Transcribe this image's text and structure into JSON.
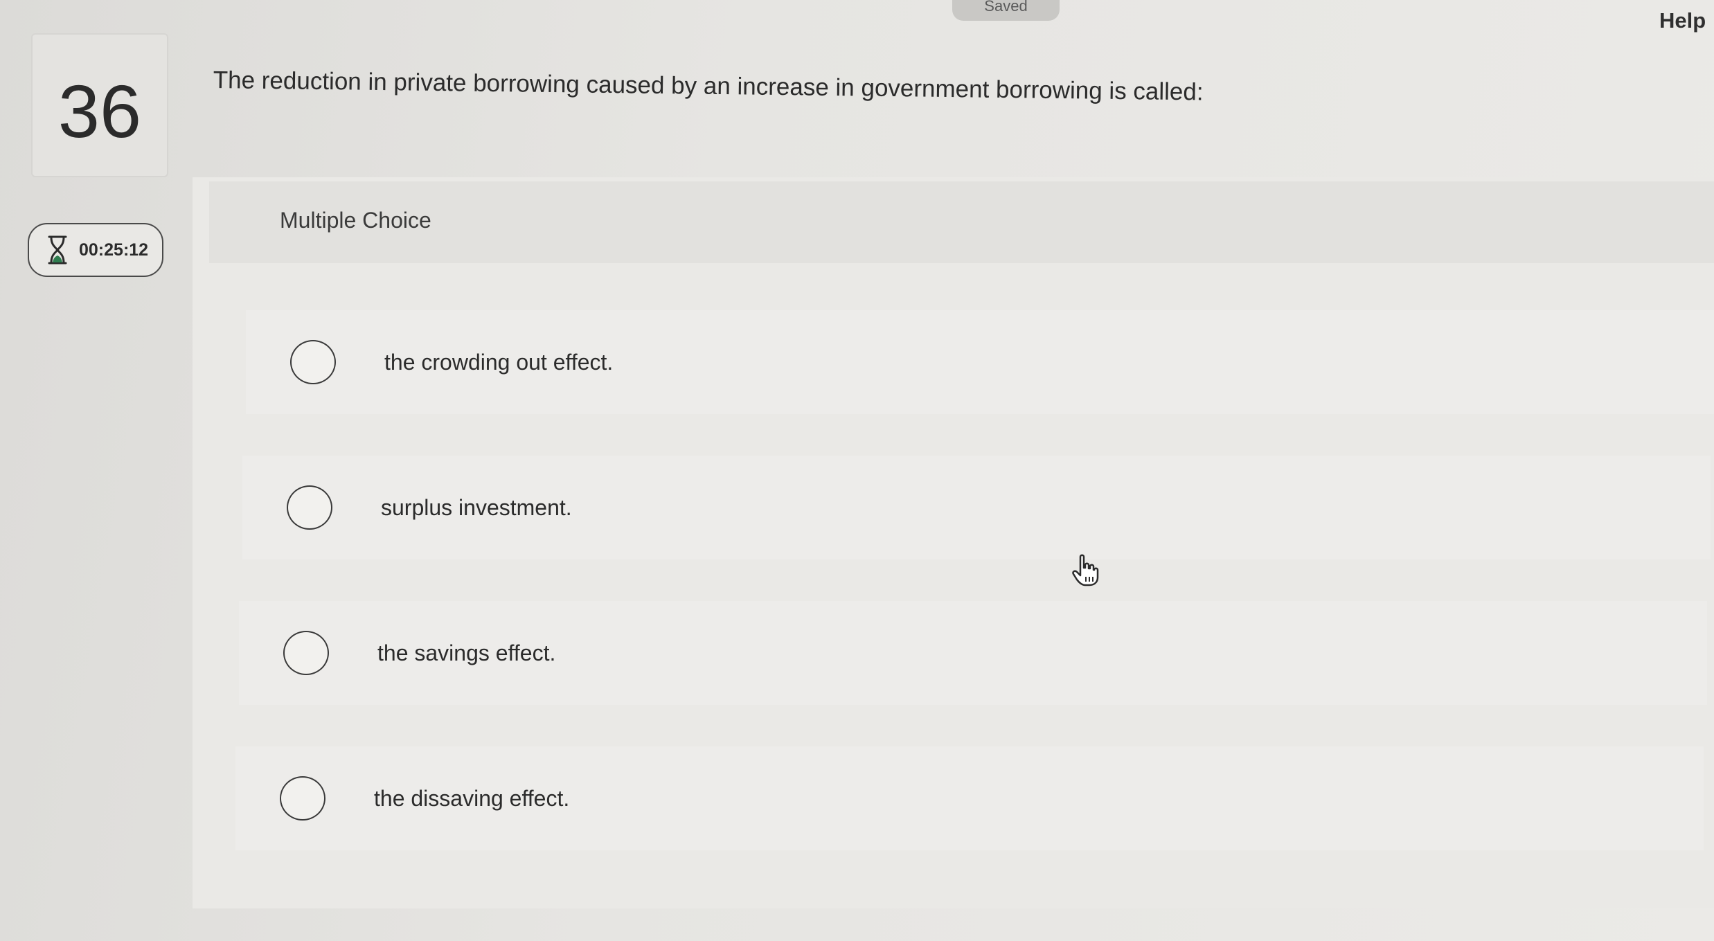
{
  "header": {
    "saved_label": "Saved",
    "help_label": "Help"
  },
  "question": {
    "number": "36",
    "text": "The reduction in private borrowing caused by an increase in government borrowing is called:"
  },
  "timer": {
    "icon": "hourglass-icon",
    "value": "00:25:12"
  },
  "answer_area": {
    "type_label": "Multiple Choice",
    "options": [
      {
        "label": "the crowding out effect."
      },
      {
        "label": "surplus investment."
      },
      {
        "label": "the savings effect."
      },
      {
        "label": "the dissaving effect."
      }
    ]
  },
  "colors": {
    "background": "#e6e5e2",
    "text": "#2b2b2b",
    "radio_border": "#3a3a3a"
  }
}
